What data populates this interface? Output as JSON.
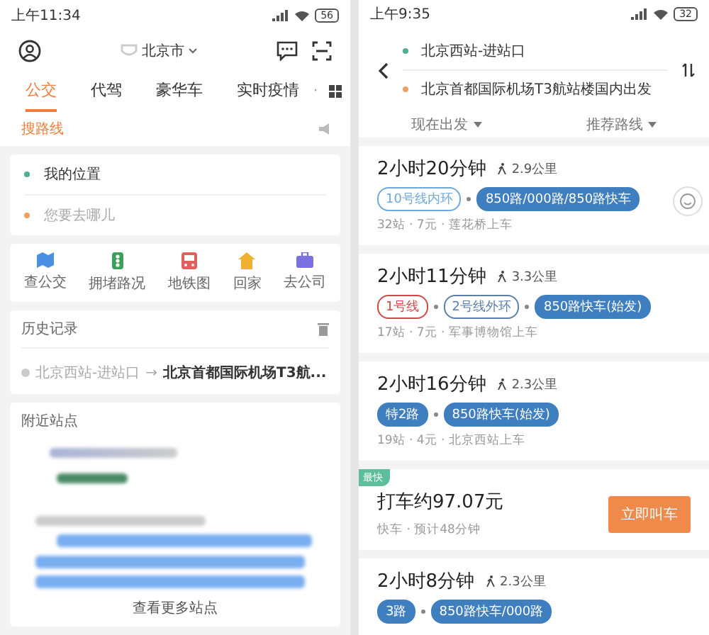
{
  "left": {
    "status_bar": {
      "time": "上午11:34",
      "battery": "56"
    },
    "header": {
      "city": "北京市"
    },
    "tabs": [
      {
        "label": "公交",
        "selected": true
      },
      {
        "label": "代驾",
        "selected": false
      },
      {
        "label": "豪华车",
        "selected": false
      },
      {
        "label": "实时疫情",
        "selected": false
      }
    ],
    "more_dot": "·",
    "search_route": {
      "label": "搜路线"
    },
    "search": {
      "from_placeholder": "我的位置",
      "to_placeholder": "您要去哪儿"
    },
    "shortcuts": [
      {
        "label": "查公交",
        "color": "#4a90e2",
        "kind": "map"
      },
      {
        "label": "拥堵路况",
        "color": "#3aa05a",
        "kind": "traffic"
      },
      {
        "label": "地铁图",
        "color": "#e06060",
        "kind": "subway"
      },
      {
        "label": "回家",
        "color": "#f0b030",
        "kind": "home"
      },
      {
        "label": "去公司",
        "color": "#7a70e0",
        "kind": "work"
      }
    ],
    "history": {
      "title": "历史记录",
      "items": [
        {
          "from": "北京西站-进站口",
          "arrow": "→",
          "to": "北京首都国际机场T3航..."
        }
      ]
    },
    "nearby": {
      "title": "附近站点",
      "more": "查看更多站点"
    }
  },
  "right": {
    "status_bar": {
      "time": "上午9:35",
      "battery": "32"
    },
    "route": {
      "from": "北京西站-进站口",
      "to": "北京首都国际机场T3航站楼国内出发"
    },
    "filters": [
      {
        "label": "现在出发"
      },
      {
        "label": "推荐路线"
      }
    ],
    "results": [
      {
        "kind": "transit",
        "duration": "2小时20分钟",
        "walk": "2.9公里",
        "segments": [
          {
            "kind": "line",
            "label": "10号线内环",
            "color": "#6fa8dc"
          },
          {
            "kind": "bus",
            "label": "850路/000路/850路快车",
            "color": "#3f7fc0"
          }
        ],
        "meta": "32站 · 7元 · 莲花桥上车"
      },
      {
        "kind": "transit",
        "duration": "2小时11分钟",
        "walk": "3.3公里",
        "segments": [
          {
            "kind": "line",
            "label": "1号线",
            "color": "#d04848"
          },
          {
            "kind": "line",
            "label": "2号线外环",
            "color": "#5a7fa8"
          },
          {
            "kind": "bus",
            "label": "850路快车(始发)",
            "color": "#3f7fc0"
          }
        ],
        "meta": "17站 · 7元 · 军事博物馆上车"
      },
      {
        "kind": "transit",
        "duration": "2小时16分钟",
        "walk": "2.3公里",
        "segments": [
          {
            "kind": "bus",
            "label": "特2路",
            "color": "#3f7fc0"
          },
          {
            "kind": "bus",
            "label": "850路快车(始发)",
            "color": "#3f7fc0"
          }
        ],
        "meta": "19站 · 4元 · 北京西站上车"
      },
      {
        "kind": "taxi",
        "badge": "最快",
        "title": "打车约97.07元",
        "meta": "快车 · 预计48分钟",
        "button": "立即叫车"
      },
      {
        "kind": "transit",
        "duration": "2小时8分钟",
        "walk": "2.3公里",
        "segments": [
          {
            "kind": "bus",
            "label": "3路",
            "color": "#3f7fc0"
          },
          {
            "kind": "bus",
            "label": "850路快车/000路",
            "color": "#3f7fc0"
          }
        ]
      }
    ]
  }
}
